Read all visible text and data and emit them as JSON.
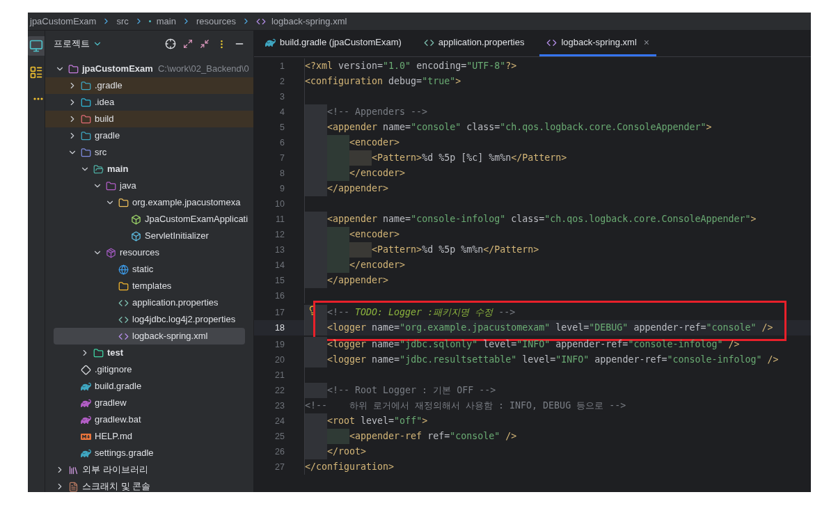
{
  "breadcrumb": [
    {
      "kind": "plain",
      "label": "jpaCustomExam"
    },
    {
      "kind": "plain",
      "label": "src"
    },
    {
      "kind": "module",
      "label": "main"
    },
    {
      "kind": "plain",
      "label": "resources"
    },
    {
      "kind": "xml",
      "label": "logback-spring.xml"
    }
  ],
  "tool_strip": [
    {
      "kind": "project",
      "selected": true
    },
    {
      "kind": "structure",
      "selected": false
    },
    {
      "kind": "more",
      "selected": false
    }
  ],
  "project_panel": {
    "title": "프로젝트",
    "tree": [
      {
        "label": "jpaCustomExam",
        "path": "C:\\work\\02_Backend\\0",
        "kind": "module",
        "bold": true,
        "expanded": true,
        "excluded": false,
        "selected": false,
        "children": [
          {
            "label": ".gradle",
            "kind": "gradle-folder",
            "expanded": false,
            "excluded": true,
            "selected": false
          },
          {
            "label": ".idea",
            "kind": "idea-folder",
            "expanded": false,
            "excluded": false,
            "selected": false
          },
          {
            "label": "build",
            "kind": "build-folder",
            "expanded": false,
            "excluded": true,
            "selected": false
          },
          {
            "label": "gradle",
            "kind": "gradle-folder",
            "expanded": false,
            "excluded": false,
            "selected": false
          },
          {
            "label": "src",
            "kind": "src-folder",
            "expanded": true,
            "excluded": false,
            "selected": false,
            "children": [
              {
                "label": "main",
                "kind": "main-folder",
                "bold": true,
                "expanded": true,
                "excluded": false,
                "selected": false,
                "children": [
                  {
                    "label": "java",
                    "kind": "java-folder",
                    "expanded": true,
                    "excluded": false,
                    "selected": false,
                    "children": [
                      {
                        "label": "org.example.jpacustomexa",
                        "kind": "package",
                        "expanded": true,
                        "excluded": false,
                        "selected": false,
                        "children": [
                          {
                            "label": "JpaCustomExamApplicati",
                            "kind": "spring-class",
                            "excluded": false,
                            "selected": false
                          },
                          {
                            "label": "ServletInitializer",
                            "kind": "class",
                            "excluded": false,
                            "selected": false
                          }
                        ]
                      }
                    ]
                  },
                  {
                    "label": "resources",
                    "kind": "resources-folder",
                    "expanded": true,
                    "excluded": false,
                    "selected": false,
                    "children": [
                      {
                        "label": "static",
                        "kind": "static-folder",
                        "excluded": false,
                        "selected": false
                      },
                      {
                        "label": "templates",
                        "kind": "templates-folder",
                        "excluded": false,
                        "selected": false
                      },
                      {
                        "label": "application.properties",
                        "kind": "properties",
                        "excluded": false,
                        "selected": false
                      },
                      {
                        "label": "log4jdbc.log4j2.properties",
                        "kind": "properties",
                        "excluded": false,
                        "selected": false
                      },
                      {
                        "label": "logback-spring.xml",
                        "kind": "xml",
                        "excluded": false,
                        "selected": true
                      }
                    ]
                  }
                ]
              },
              {
                "label": "test",
                "kind": "test-folder",
                "bold": true,
                "expanded": false,
                "excluded": false,
                "selected": false
              }
            ]
          },
          {
            "label": ".gitignore",
            "kind": "git",
            "excluded": false,
            "selected": false
          },
          {
            "label": "build.gradle",
            "kind": "gradle",
            "excluded": false,
            "selected": false
          },
          {
            "label": "gradlew",
            "kind": "gradlew",
            "excluded": false,
            "selected": false
          },
          {
            "label": "gradlew.bat",
            "kind": "gradlew",
            "excluded": false,
            "selected": false
          },
          {
            "label": "HELP.md",
            "kind": "markdown",
            "excluded": false,
            "selected": false
          },
          {
            "label": "settings.gradle",
            "kind": "gradle",
            "excluded": false,
            "selected": false
          }
        ]
      },
      {
        "label": "외부 라이브러리",
        "kind": "library",
        "expanded": false,
        "excluded": false,
        "selected": false
      },
      {
        "label": "스크래치 및 콘솔",
        "kind": "scratch",
        "expanded": false,
        "excluded": false,
        "selected": false
      }
    ]
  },
  "tabs": [
    {
      "label": "build.gradle (jpaCustomExam)",
      "kind": "gradle",
      "selected": false
    },
    {
      "label": "application.properties",
      "kind": "properties",
      "selected": false
    },
    {
      "label": "logback-spring.xml",
      "kind": "xml",
      "selected": true,
      "close": "×"
    }
  ],
  "editor": {
    "lines": [
      {
        "number": "1",
        "segments": [
          {
            "kind": "tag",
            "t": "<?xml"
          },
          {
            "kind": "attr",
            "t": " version="
          },
          {
            "kind": "value",
            "t": "\"1.0\""
          },
          {
            "kind": "attr",
            "t": " encoding="
          },
          {
            "kind": "value",
            "t": "\"UTF-8\""
          },
          {
            "kind": "tag",
            "t": "?>"
          }
        ]
      },
      {
        "number": "2",
        "segments": [
          {
            "kind": "tag",
            "t": "<configuration"
          },
          {
            "kind": "attr",
            "t": " debug="
          },
          {
            "kind": "value",
            "t": "\"true\""
          },
          {
            "kind": "tag",
            "t": ">"
          }
        ]
      },
      {
        "number": "3"
      },
      {
        "number": "4",
        "segments": [
          {
            "kind": "comment",
            "t": "    <!-- Appenders -->"
          }
        ]
      },
      {
        "number": "5",
        "segments": [
          {
            "kind": "tag",
            "t": "    <appender"
          },
          {
            "kind": "attr",
            "t": " name="
          },
          {
            "kind": "value",
            "t": "\"console\""
          },
          {
            "kind": "attr",
            "t": " class="
          },
          {
            "kind": "value",
            "t": "\"ch.qos.logback.core.ConsoleAppender\""
          },
          {
            "kind": "tag",
            "t": ">"
          }
        ]
      },
      {
        "number": "6",
        "segments": [
          {
            "kind": "tag",
            "t": "        <encoder>"
          }
        ]
      },
      {
        "number": "7",
        "segments": [
          {
            "kind": "tag",
            "t": "            <Pattern>"
          },
          {
            "kind": "text",
            "t": "%d %5p [%c] %m%n"
          },
          {
            "kind": "tag",
            "t": "</Pattern>"
          }
        ]
      },
      {
        "number": "8",
        "segments": [
          {
            "kind": "tag",
            "t": "        </encoder>"
          }
        ]
      },
      {
        "number": "9",
        "segments": [
          {
            "kind": "tag",
            "t": "    </appender>"
          }
        ]
      },
      {
        "number": "10"
      },
      {
        "number": "11",
        "segments": [
          {
            "kind": "tag",
            "t": "    <appender"
          },
          {
            "kind": "attr",
            "t": " name="
          },
          {
            "kind": "value",
            "t": "\"console-infolog\""
          },
          {
            "kind": "attr",
            "t": " class="
          },
          {
            "kind": "value",
            "t": "\"ch.qos.logback.core.ConsoleAppender\""
          },
          {
            "kind": "tag",
            "t": ">"
          }
        ]
      },
      {
        "number": "12",
        "segments": [
          {
            "kind": "tag",
            "t": "        <encoder>"
          }
        ]
      },
      {
        "number": "13",
        "segments": [
          {
            "kind": "tag",
            "t": "            <Pattern>"
          },
          {
            "kind": "text",
            "t": "%d %5p %m%n"
          },
          {
            "kind": "tag",
            "t": "</Pattern>"
          }
        ]
      },
      {
        "number": "14",
        "segments": [
          {
            "kind": "tag",
            "t": "        </encoder>"
          }
        ]
      },
      {
        "number": "15",
        "segments": [
          {
            "kind": "tag",
            "t": "    </appender>"
          }
        ]
      },
      {
        "number": "16"
      },
      {
        "number": "17",
        "bulb": true,
        "boxed": true,
        "segments": [
          {
            "kind": "comment",
            "t": "    <!-- "
          },
          {
            "kind": "todo",
            "t": "TODO: Logger :패키지명 수정"
          },
          {
            "kind": "comment",
            "t": " -->"
          }
        ]
      },
      {
        "number": "18",
        "current": true,
        "boxed": true,
        "segments": [
          {
            "kind": "tag",
            "t": "    <logger"
          },
          {
            "kind": "attr",
            "t": " name="
          },
          {
            "kind": "value",
            "t": "\"org.example.jpacustomexam\""
          },
          {
            "kind": "attr",
            "t": " level="
          },
          {
            "kind": "value",
            "t": "\"DEBUG\""
          },
          {
            "kind": "attr",
            "t": " appender-ref="
          },
          {
            "kind": "value",
            "t": "\"console\""
          },
          {
            "kind": "tag",
            "t": " />"
          }
        ]
      },
      {
        "number": "19",
        "segments": [
          {
            "kind": "tag",
            "t": "    <logger"
          },
          {
            "kind": "attr",
            "t": " name="
          },
          {
            "kind": "value",
            "t": "\"jdbc.sqlonly\""
          },
          {
            "kind": "attr",
            "t": " level="
          },
          {
            "kind": "value",
            "t": "\"INFO\""
          },
          {
            "kind": "attr",
            "t": " appender-ref="
          },
          {
            "kind": "value",
            "t": "\"console-infolog\""
          },
          {
            "kind": "tag",
            "t": " />"
          }
        ]
      },
      {
        "number": "20",
        "segments": [
          {
            "kind": "tag",
            "t": "    <logger"
          },
          {
            "kind": "attr",
            "t": " name="
          },
          {
            "kind": "value",
            "t": "\"jdbc.resultsettable\""
          },
          {
            "kind": "attr",
            "t": " level="
          },
          {
            "kind": "value",
            "t": "\"INFO\""
          },
          {
            "kind": "attr",
            "t": " appender-ref="
          },
          {
            "kind": "value",
            "t": "\"console-infolog\""
          },
          {
            "kind": "tag",
            "t": " />"
          }
        ]
      },
      {
        "number": "21"
      },
      {
        "number": "22",
        "segments": [
          {
            "kind": "comment",
            "t": "    <!-- Root Logger : 기본 OFF -->"
          }
        ]
      },
      {
        "number": "23",
        "segments": [
          {
            "kind": "comment",
            "t": "<!--    하위 로거에서 재정의해서 사용함 : INFO, DEBUG 등으로 -->"
          }
        ]
      },
      {
        "number": "24",
        "segments": [
          {
            "kind": "tag",
            "t": "    <root"
          },
          {
            "kind": "attr",
            "t": " level="
          },
          {
            "kind": "value",
            "t": "\"off\""
          },
          {
            "kind": "tag",
            "t": ">"
          }
        ]
      },
      {
        "number": "25",
        "segments": [
          {
            "kind": "tag",
            "t": "        <appender-ref"
          },
          {
            "kind": "attr",
            "t": " ref="
          },
          {
            "kind": "value",
            "t": "\"console\""
          },
          {
            "kind": "tag",
            "t": " />"
          }
        ]
      },
      {
        "number": "26",
        "segments": [
          {
            "kind": "tag",
            "t": "    </root>"
          }
        ]
      },
      {
        "number": "27",
        "segments": [
          {
            "kind": "tag",
            "t": "</configuration>"
          }
        ]
      }
    ]
  }
}
